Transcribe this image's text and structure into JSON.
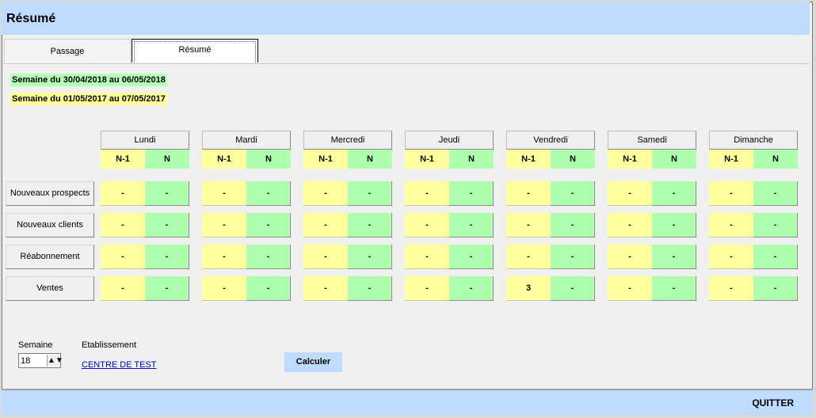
{
  "window": {
    "title": "Résumé"
  },
  "tabs": [
    {
      "label": "Passage"
    },
    {
      "label": "Résumé"
    }
  ],
  "weeks": {
    "current": "Semaine du 30/04/2018 au 06/05/2018",
    "previous": "Semaine du 01/05/2017 au 07/05/2017"
  },
  "subheaders": {
    "prev": "N-1",
    "curr": "N"
  },
  "days": [
    "Lundi",
    "Mardi",
    "Mercredi",
    "Jeudi",
    "Vendredi",
    "Samedi",
    "Dimanche"
  ],
  "rows": [
    {
      "label": "Nouveaux prospects",
      "values": [
        [
          "-",
          "-"
        ],
        [
          "-",
          "-"
        ],
        [
          "-",
          "-"
        ],
        [
          "-",
          "-"
        ],
        [
          "-",
          "-"
        ],
        [
          "-",
          "-"
        ],
        [
          "-",
          "-"
        ]
      ]
    },
    {
      "label": "Nouveaux clients",
      "values": [
        [
          "-",
          "-"
        ],
        [
          "-",
          "-"
        ],
        [
          "-",
          "-"
        ],
        [
          "-",
          "-"
        ],
        [
          "-",
          "-"
        ],
        [
          "-",
          "-"
        ],
        [
          "-",
          "-"
        ]
      ]
    },
    {
      "label": "Réabonnement",
      "values": [
        [
          "-",
          "-"
        ],
        [
          "-",
          "-"
        ],
        [
          "-",
          "-"
        ],
        [
          "-",
          "-"
        ],
        [
          "-",
          "-"
        ],
        [
          "-",
          "-"
        ],
        [
          "-",
          "-"
        ]
      ]
    },
    {
      "label": "Ventes",
      "values": [
        [
          "-",
          "-"
        ],
        [
          "-",
          "-"
        ],
        [
          "-",
          "-"
        ],
        [
          "-",
          "-"
        ],
        [
          "3",
          "-"
        ],
        [
          "-",
          "-"
        ],
        [
          "-",
          "-"
        ]
      ]
    }
  ],
  "footer": {
    "semaine_label": "Semaine",
    "semaine_value": "18",
    "etablissement_label": "Etablissement",
    "etablissement_value": "CENTRE DE TEST",
    "calculer": "Calculer",
    "quitter": "QUITTER"
  },
  "colors": {
    "header": "#bfdbff",
    "n1": "#ffff9f",
    "n": "#adffad"
  }
}
